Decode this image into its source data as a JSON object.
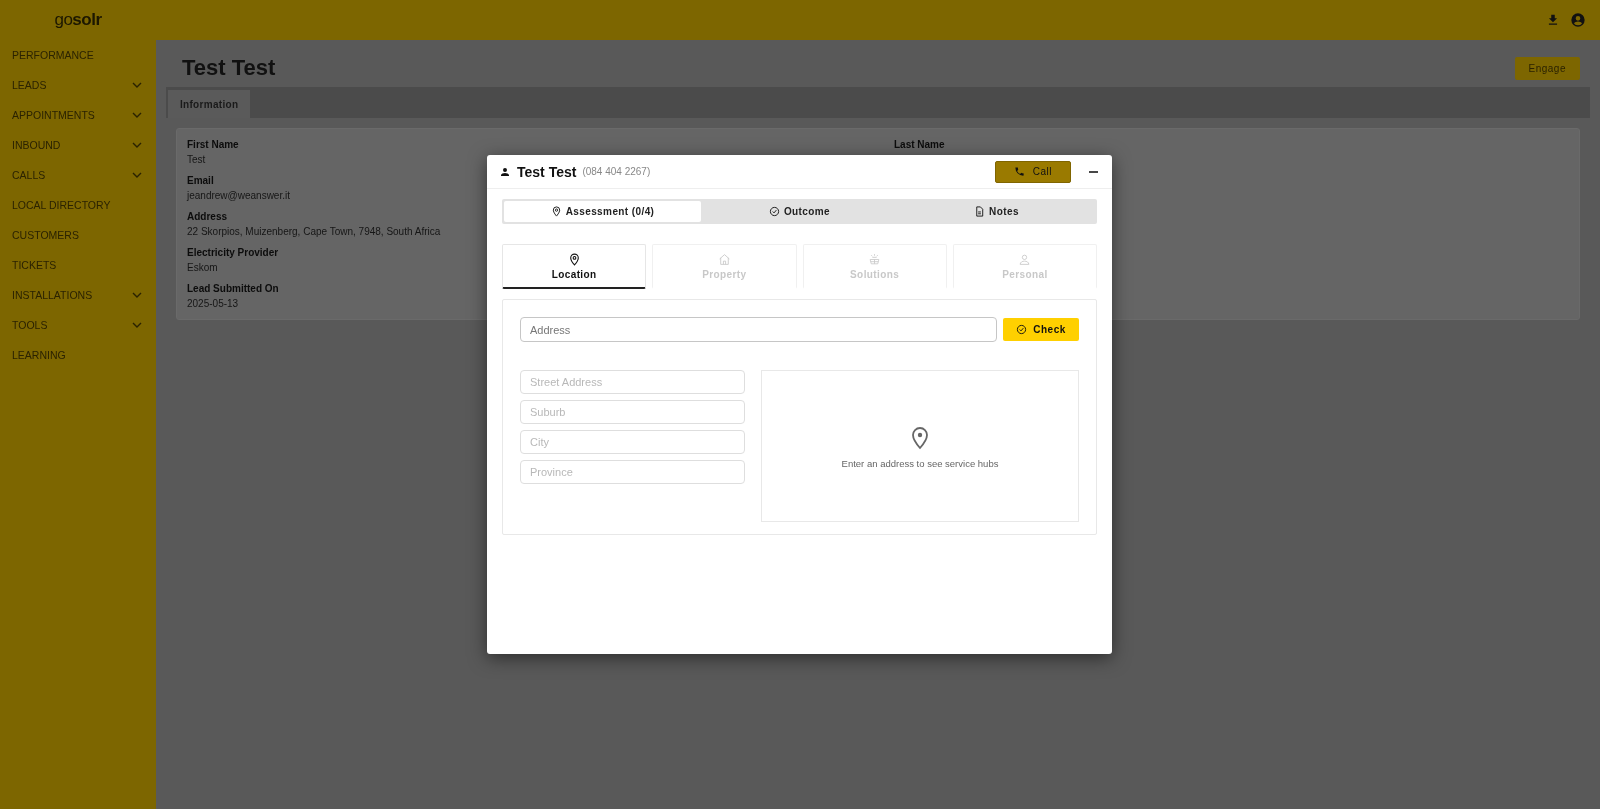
{
  "brand": {
    "logo": "go**solr**"
  },
  "sidebar": {
    "items": [
      {
        "label": "PERFORMANCE",
        "expandable": false
      },
      {
        "label": "LEADS",
        "expandable": true
      },
      {
        "label": "APPOINTMENTS",
        "expandable": true
      },
      {
        "label": "INBOUND",
        "expandable": true
      },
      {
        "label": "CALLS",
        "expandable": true
      },
      {
        "label": "LOCAL DIRECTORY",
        "expandable": false
      },
      {
        "label": "CUSTOMERS",
        "expandable": false
      },
      {
        "label": "TICKETS",
        "expandable": false
      },
      {
        "label": "INSTALLATIONS",
        "expandable": true
      },
      {
        "label": "TOOLS",
        "expandable": true
      },
      {
        "label": "LEARNING",
        "expandable": false
      }
    ]
  },
  "page": {
    "title": "Test Test",
    "engage_button": "Engage",
    "tabs": [
      {
        "label": "Information",
        "selected": true
      }
    ],
    "left_fields": [
      {
        "label": "First Name",
        "value": "Test"
      },
      {
        "label": "Email",
        "value": "jeandrew@weanswer.it"
      },
      {
        "label": "Address",
        "value": "22 Skorpios, Muizenberg, Cape Town, 7948, South Africa"
      },
      {
        "label": "Electricity Provider",
        "value": "Eskom"
      },
      {
        "label": "Lead Submitted On",
        "value": "2025-05-13"
      }
    ],
    "right_fields": [
      {
        "label": "Last Name"
      }
    ]
  },
  "modal": {
    "name": "Test Test",
    "phone": "(084 404 2267)",
    "call_button": "Call",
    "tabs": [
      {
        "label": "Assessment (0/4)",
        "kind": "pin",
        "selected": true
      },
      {
        "label": "Outcome",
        "kind": "check",
        "selected": false
      },
      {
        "label": "Notes",
        "kind": "file",
        "selected": false
      }
    ],
    "steps": [
      {
        "label": "Location",
        "kind": "pin",
        "selected": true,
        "disabled": false
      },
      {
        "label": "Property",
        "kind": "home",
        "selected": false,
        "disabled": true
      },
      {
        "label": "Solutions",
        "kind": "solar",
        "selected": false,
        "disabled": true
      },
      {
        "label": "Personal",
        "kind": "person",
        "selected": false,
        "disabled": true
      }
    ],
    "address_field": {
      "placeholder": "Address"
    },
    "check_button": "Check",
    "fields": [
      {
        "placeholder": "Street Address"
      },
      {
        "placeholder": "Suburb"
      },
      {
        "placeholder": "City"
      },
      {
        "placeholder": "Province"
      }
    ],
    "map_message": "Enter an address to see service hubs"
  }
}
